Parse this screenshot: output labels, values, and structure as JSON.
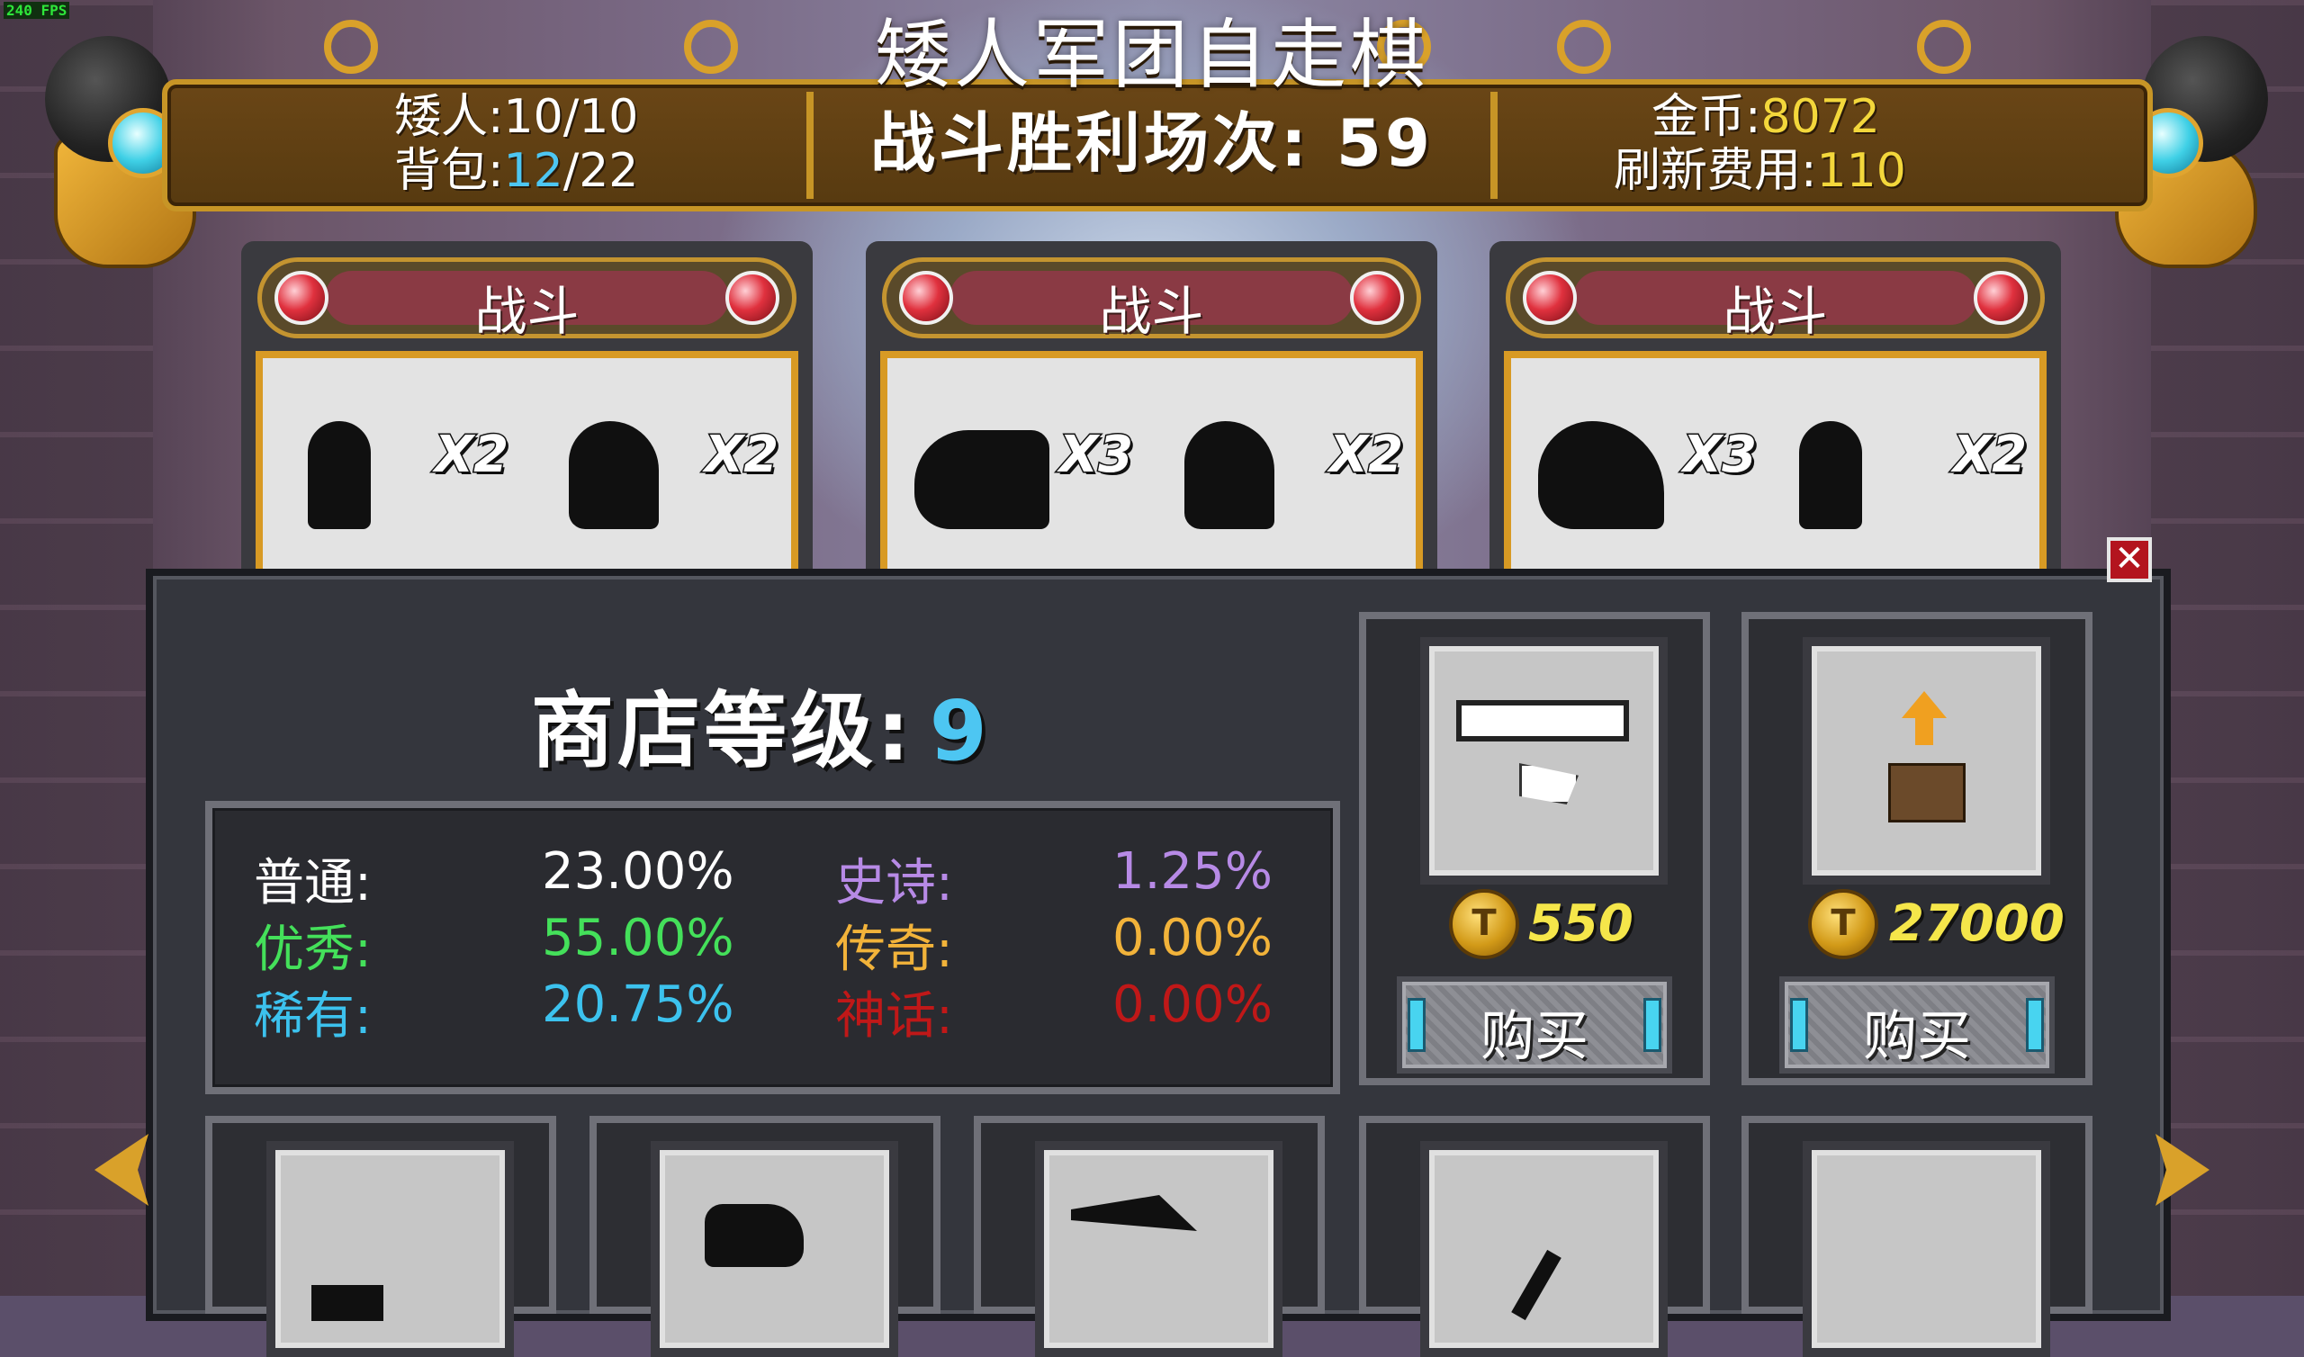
{
  "fps": "240 FPS",
  "title": "矮人军团自走棋",
  "header": {
    "dwarves_label": "矮人:",
    "dwarves_value": "10/10",
    "bag_label": "背包:",
    "bag_used": "12",
    "bag_total": "/22",
    "wins_label": "战斗胜利场次:",
    "wins_value": "59",
    "gold_label": "金币:",
    "gold_value": "8072",
    "refresh_label": "刷新费用:",
    "refresh_value": "110"
  },
  "battles": [
    {
      "label": "战斗",
      "mult1": "X2",
      "mult2": "X2"
    },
    {
      "label": "战斗",
      "mult1": "X3",
      "mult2": "X2"
    },
    {
      "label": "战斗",
      "mult1": "X3",
      "mult2": "X2"
    }
  ],
  "close_icon": "close-icon",
  "shop": {
    "level_label": "商店等级:",
    "level_value": "9",
    "rates": {
      "common_label": "普通:",
      "common_value": "23.00%",
      "good_label": "优秀:",
      "good_value": "55.00%",
      "rare_label": "稀有:",
      "rare_value": "20.75%",
      "epic_label": "史诗:",
      "epic_value": "1.25%",
      "legend_label": "传奇:",
      "legend_value": "0.00%",
      "myth_label": "神话:",
      "myth_value": "0.00%"
    },
    "items": [
      {
        "icon": "banner-flag-icon",
        "price": "550",
        "buy_label": "购买"
      },
      {
        "icon": "chest-upgrade-icon",
        "price": "27000",
        "buy_label": "购买"
      }
    ],
    "coin_symbol": "T"
  },
  "colors": {
    "rare_blue": "#4dc6f2",
    "gold_yellow": "#f3d73b",
    "good_green": "#44e05a",
    "epic_purple": "#b78ae6",
    "legend_orange": "#f2b33a",
    "myth_red": "#c01818",
    "banner_gold": "#c79526",
    "close_red": "#b3141e"
  }
}
